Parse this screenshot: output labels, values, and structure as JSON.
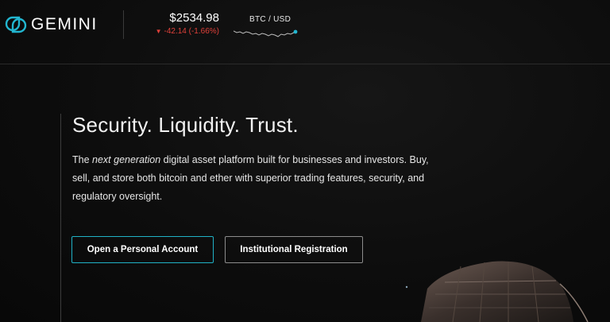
{
  "header": {
    "logo_text": "GEMINI",
    "ticker": {
      "price": "$2534.98",
      "change": "-42.14 (-1.66%)",
      "pair": "BTC / USD",
      "change_direction_icon": "triangle-down-icon"
    }
  },
  "hero": {
    "title": "Security. Liquidity. Trust.",
    "desc_prefix": "The ",
    "desc_emphasis": "next generation",
    "desc_suffix": " digital asset platform built for businesses and investors. Buy, sell, and store both bitcoin and ether with superior trading features, security, and regulatory oversight.",
    "buttons": {
      "personal_label": "Open a Personal Account",
      "institutional_label": "Institutional Registration"
    }
  },
  "colors": {
    "accent": "#20b2c6",
    "negative": "#e0413a",
    "background": "#0c0c0c"
  }
}
